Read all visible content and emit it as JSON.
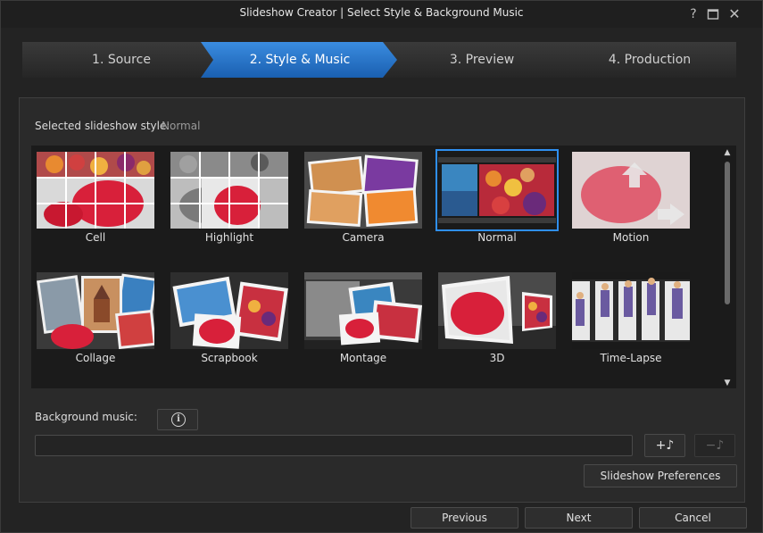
{
  "window": {
    "title": "Slideshow Creator | Select Style & Background Music",
    "help_icon": "?",
    "maximize_icon": "☐",
    "close_icon": "✕"
  },
  "steps": [
    {
      "label": "1. Source",
      "active": false
    },
    {
      "label": "2. Style & Music",
      "active": true
    },
    {
      "label": "3. Preview",
      "active": false
    },
    {
      "label": "4. Production",
      "active": false
    }
  ],
  "style": {
    "selected_label": "Selected slideshow style:",
    "selected_value": "Normal"
  },
  "styles": [
    {
      "label": "Cell"
    },
    {
      "label": "Highlight"
    },
    {
      "label": "Camera"
    },
    {
      "label": "Normal",
      "selected": true
    },
    {
      "label": "Motion"
    },
    {
      "label": "Collage"
    },
    {
      "label": "Scrapbook"
    },
    {
      "label": "Montage"
    },
    {
      "label": "3D"
    },
    {
      "label": "Time-Lapse"
    }
  ],
  "music": {
    "label": "Background music:",
    "info_icon": "i",
    "field_value": "",
    "add_label": "+♪",
    "remove_label": "−♪"
  },
  "buttons": {
    "preferences": "Slideshow Preferences",
    "previous": "Previous",
    "next": "Next",
    "cancel": "Cancel"
  },
  "colors": {
    "accent": "#2f8ff0",
    "active_step": "#1f6fc0"
  }
}
